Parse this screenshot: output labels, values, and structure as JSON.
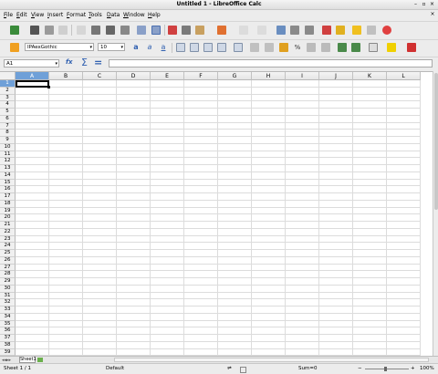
{
  "window": {
    "title": "Untitled 1 - LibreOffice Calc"
  },
  "menu": [
    {
      "label": "File",
      "underline": "F",
      "rest": "ile"
    },
    {
      "label": "Edit",
      "underline": "E",
      "rest": "dit"
    },
    {
      "label": "View",
      "underline": "V",
      "rest": "iew"
    },
    {
      "label": "Insert",
      "underline": "I",
      "rest": "nsert"
    },
    {
      "label": "Format",
      "underline": "F",
      "rest": "ormat",
      "pre": ""
    },
    {
      "label": "Tools",
      "underline": "T",
      "rest": "ools"
    },
    {
      "label": "Data",
      "underline": "D",
      "rest": "ata"
    },
    {
      "label": "Window",
      "underline": "W",
      "rest": "indow"
    },
    {
      "label": "Help",
      "underline": "H",
      "rest": "elp"
    }
  ],
  "formatting": {
    "font_name": "IPAexGothic",
    "font_size": "10"
  },
  "formula_bar": {
    "name_box": "A1",
    "function_wizard_glyph": "fx",
    "sum_glyph": "Σ",
    "equals_glyph": "=",
    "formula": ""
  },
  "columns": [
    "A",
    "B",
    "C",
    "D",
    "E",
    "F",
    "G",
    "H",
    "I",
    "J",
    "K",
    "L"
  ],
  "rows": [
    "1",
    "2",
    "3",
    "4",
    "5",
    "6",
    "7",
    "8",
    "9",
    "10",
    "11",
    "12",
    "13",
    "14",
    "15",
    "16",
    "17",
    "18",
    "19",
    "20",
    "21",
    "22",
    "23",
    "24",
    "25",
    "26",
    "27",
    "28",
    "29",
    "30",
    "31",
    "32",
    "33",
    "34",
    "35",
    "36",
    "37",
    "38",
    "39"
  ],
  "active_cell": "A1",
  "sheet_tabs": [
    "Sheet1"
  ],
  "status": {
    "sheet": "Sheet 1 / 1",
    "style": "Default",
    "sum": "Sum=0",
    "zoom": "100%"
  },
  "colors": {
    "accent_header": "#6fa0d8",
    "selection_border": "#000000"
  }
}
